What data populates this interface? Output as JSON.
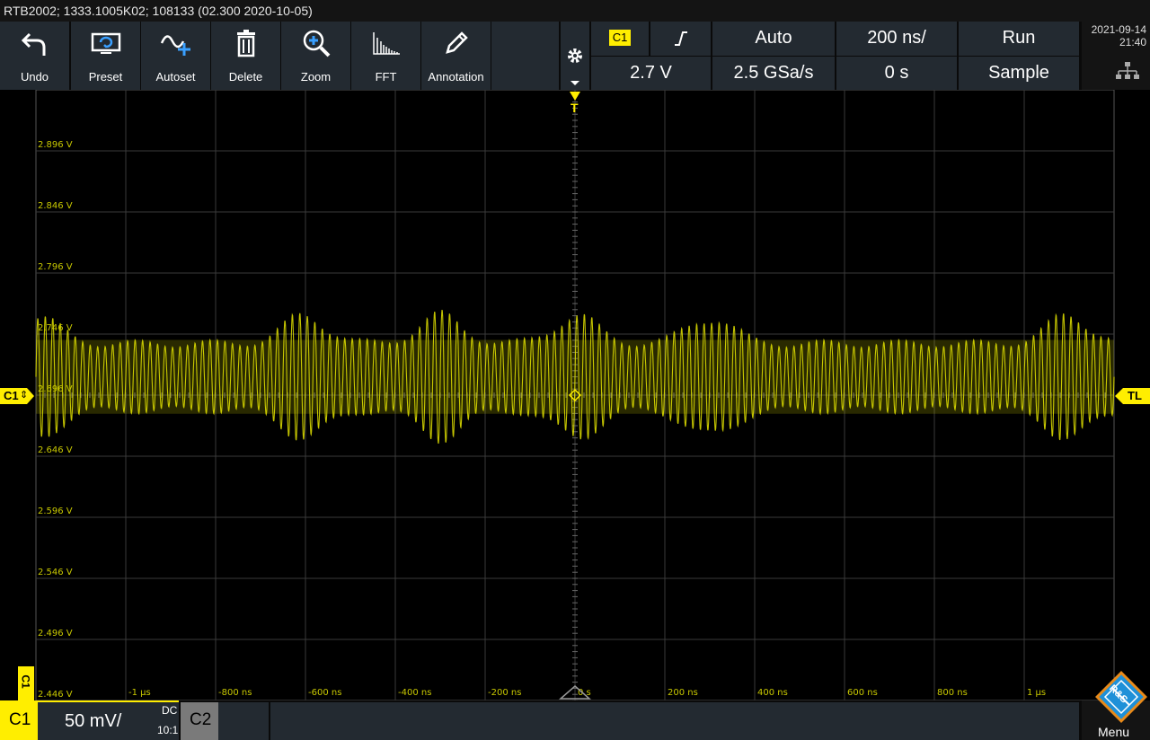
{
  "titlebar": "RTB2002; 1333.1005K02; 108133 (02.300 2020-10-05)",
  "toolbar": {
    "undo": "Undo",
    "preset": "Preset",
    "autoset": "Autoset",
    "delete": "Delete",
    "zoom": "Zoom",
    "fft": "FFT",
    "annotation": "Annotation"
  },
  "trigger": {
    "source": "C1",
    "slope_symbol": "⌠",
    "mode": "Auto",
    "level": "2.7 V",
    "timebase": "200 ns/",
    "sample_rate": "2.5 GSa/s",
    "acq_state": "Run",
    "offset": "0 s",
    "acq_mode": "Sample"
  },
  "clock": {
    "date": "2021-09-14",
    "time": "21:40"
  },
  "y_labels": [
    "2.896 V",
    "2.846 V",
    "2.796 V",
    "2.746 V",
    "2.696 V",
    "2.646 V",
    "2.596 V",
    "2.546 V",
    "2.496 V",
    "2.446 V"
  ],
  "x_labels": [
    "-1 µs",
    "-800 ns",
    "-600 ns",
    "-400 ns",
    "-200 ns",
    "0 s",
    "200 ns",
    "400 ns",
    "600 ns",
    "800 ns",
    "1 µs"
  ],
  "markers": {
    "channel": "C1",
    "trigger_level": "TL",
    "trigger_pos": "T",
    "channel_vertical": "C1"
  },
  "channel_bar": {
    "ch1": "C1",
    "scale": "50 mV/",
    "coupling": "DC",
    "probe": "10:1",
    "ch2": "C2"
  },
  "menu": {
    "label": "Menu",
    "logo": "R&S"
  },
  "colors": {
    "trace": "#e6e600",
    "accent": "#ffee00",
    "panel": "#232a31",
    "grid": "#3a3a3a"
  },
  "chart_data": {
    "type": "line",
    "title": "",
    "xlabel": "",
    "ylabel": "",
    "xlim": [
      -1.2,
      1.2
    ],
    "x_unit": "µs",
    "ylim": [
      2.446,
      2.946
    ],
    "y_unit": "V",
    "series": [
      {
        "center": 2.711,
        "amplitude": 0.055,
        "carrier_periods_per_us": 60,
        "note_envelope_peaks_us": [
          -1.2,
          -0.6,
          -0.3,
          0.0,
          0.3,
          1.1
        ]
      }
    ],
    "grid": true
  }
}
